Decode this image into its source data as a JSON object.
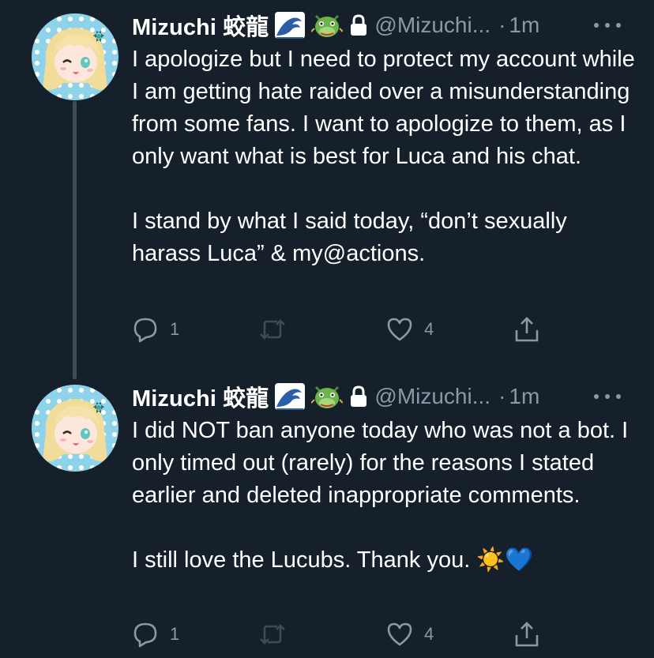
{
  "colors": {
    "background": "#15202b",
    "text": "#ffffff",
    "secondary": "#8b98a5",
    "thread_line": "#3d4b5a"
  },
  "tweets": [
    {
      "display_name": "Mizuchi 蛟龍",
      "name_emojis": [
        "water-wave-emoji",
        "dragon-face-emoji"
      ],
      "handle": "@Mizuchi...",
      "separator": "·",
      "time": "1m",
      "paragraphs": [
        "I apologize but I need to protect my account while I am getting hate raided over a misunderstanding from some fans. I want to apologize to them, as I only want what is best for Luca and his chat.",
        "I stand by what I said today, “don’t sexually harass Luca” & my@actions."
      ],
      "reply_count": "1",
      "retweet_count": "",
      "like_count": "4"
    },
    {
      "display_name": "Mizuchi 蛟龍",
      "name_emojis": [
        "water-wave-emoji",
        "dragon-face-emoji"
      ],
      "handle": "@Mizuchi...",
      "separator": "·",
      "time": "1m",
      "paragraphs": [
        "I did NOT ban anyone today who was not a bot. I only timed out (rarely) for the reasons I stated earlier and deleted inappropriate comments.",
        "I still love the Lucubs. Thank you. ☀️💙"
      ],
      "reply_count": "1",
      "retweet_count": "",
      "like_count": "4"
    }
  ]
}
